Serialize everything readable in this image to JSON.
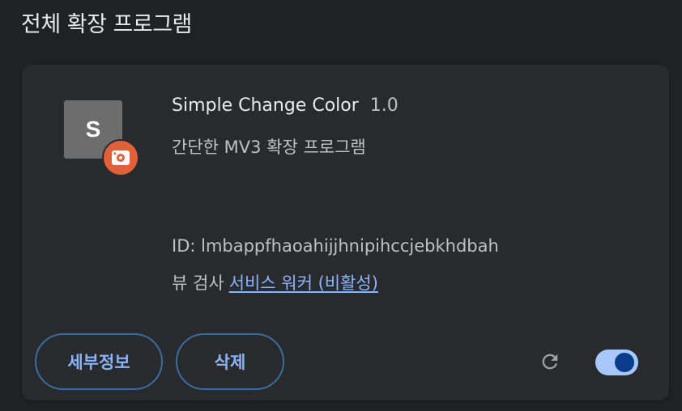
{
  "page": {
    "section_title": "전체 확장 프로그램"
  },
  "extension": {
    "icon_letter": "S",
    "icon_color": "#6d6d6d",
    "badge_icon": "unpacked-extension-icon",
    "badge_color": "#e0603a",
    "name": "Simple Change Color",
    "version": "1.0",
    "description": "간단한 MV3 확장 프로그램",
    "id_text": "ID: lmbappfhaoahijjhnipihccjebkhdbah",
    "inspect_label": "뷰 검사",
    "service_worker_link": "서비스 워커 (비활성)",
    "enabled": true
  },
  "actions": {
    "details_label": "세부정보",
    "remove_label": "삭제",
    "reload_icon": "reload-icon"
  },
  "colors": {
    "background": "#202124",
    "card": "#292a2d",
    "accent": "#8ab4f8",
    "toggle_on_track": "#a8c7fa",
    "toggle_on_knob": "#0b3b8c"
  }
}
